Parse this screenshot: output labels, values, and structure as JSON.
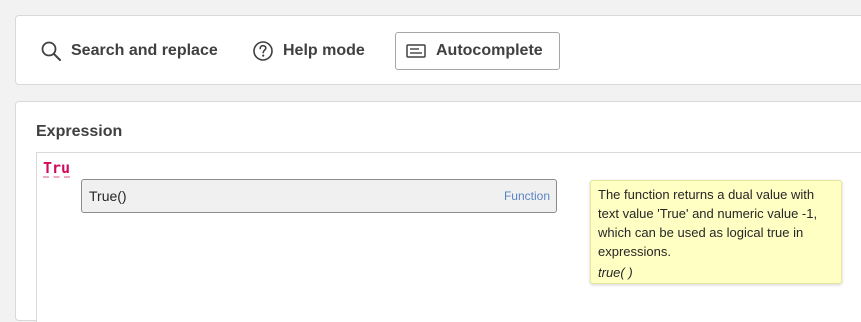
{
  "toolbar": {
    "search_replace_label": "Search and replace",
    "help_mode_label": "Help mode",
    "autocomplete_label": "Autocomplete"
  },
  "expression": {
    "title": "Expression",
    "typed_text": "Tru",
    "suggestion": {
      "name": "True()",
      "kind": "Function"
    },
    "tooltip": {
      "description": "The function returns a dual value with text value 'True' and numeric value -1, which can be used as logical true in expressions.",
      "signature": "true( )"
    }
  },
  "colors": {
    "typed_text": "#d10a5e",
    "suggestion_kind": "#5a85c5",
    "tooltip_bg": "#ffffc4"
  },
  "icons": {
    "search": "magnifier-icon",
    "help": "question-circle-icon",
    "autocomplete": "keyboard-icon"
  }
}
